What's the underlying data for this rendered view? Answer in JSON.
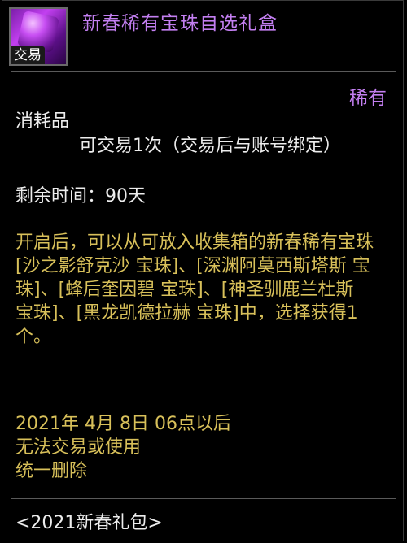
{
  "item": {
    "icon_name": "purple-treasure-box-icon",
    "icon_badge": "交易",
    "title": "新春稀有宝珠自选礼盒",
    "rarity": "稀有",
    "type": "消耗品",
    "trade_info": "可交易1次（交易后与账号绑定）",
    "remaining_time": "剩余时间：90天",
    "description": "开启后，可以从可放入收集箱的新春稀有宝珠[沙之影舒克沙 宝珠]、[深渊阿莫西斯塔斯 宝珠]、[蜂后奎因碧 宝珠]、[神圣驯鹿兰杜斯 宝珠]、[黑龙凯德拉赫 宝珠]中，选择获得1个。",
    "expiry_line1": "2021年 4月 8日 06点以后",
    "expiry_line2": "无法交易或使用",
    "expiry_line3": "统一删除",
    "package": "<2021新春礼包>"
  },
  "colors": {
    "rarity_purple": "#c37ff1",
    "desc_yellow": "#d8c05a",
    "text_white": "#ededed"
  }
}
